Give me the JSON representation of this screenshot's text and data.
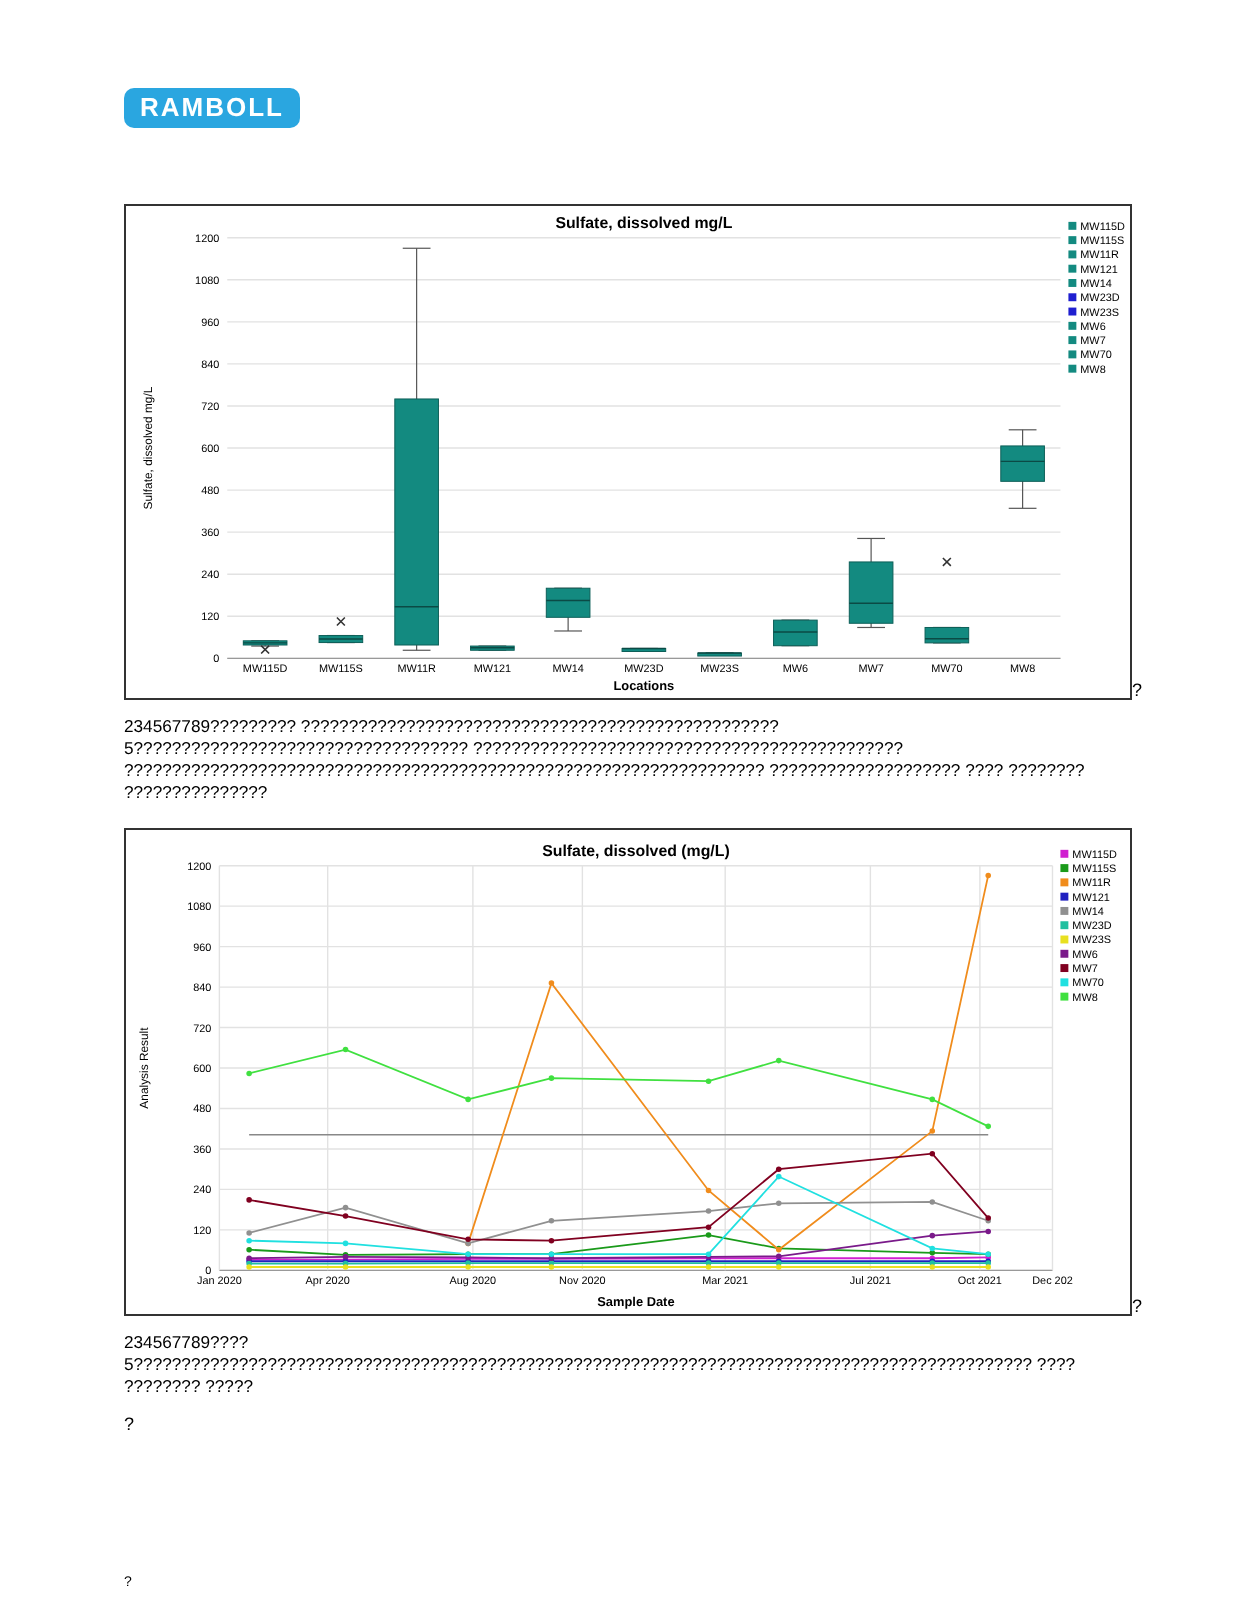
{
  "logo": {
    "text": "RAMBOLL"
  },
  "box_chart": {
    "kind": "picture",
    "title": "Sulfate, dissolved mg/L",
    "xlabel": "Locations",
    "ylabel": "Sulfate, dissolved mg/L",
    "yticks": [
      "1200",
      "1080",
      "960",
      "840",
      "720",
      "600",
      "480",
      "360",
      "240",
      "120",
      "0"
    ],
    "categories": [
      "MW115D",
      "MW115S",
      "MW11R",
      "MW121",
      "MW14",
      "MW23D",
      "MW23S",
      "MW6",
      "MW7",
      "MW70",
      "MW8"
    ],
    "legend": [
      {
        "label": "MW115D",
        "color": "#138a80"
      },
      {
        "label": "MW115S",
        "color": "#138a80"
      },
      {
        "label": "MW11R",
        "color": "#138a80"
      },
      {
        "label": "MW121",
        "color": "#138a80"
      },
      {
        "label": "MW14",
        "color": "#138a80"
      },
      {
        "label": "MW23D",
        "color": "#1f1fd0"
      },
      {
        "label": "MW23S",
        "color": "#1f1fd0"
      },
      {
        "label": "MW6",
        "color": "#138a80"
      },
      {
        "label": "MW7",
        "color": "#138a80"
      },
      {
        "label": "MW70",
        "color": "#138a80"
      },
      {
        "label": "MW8",
        "color": "#138a80"
      }
    ]
  },
  "mark_1": "?",
  "paragraph_1": "234567789????????? ??????????????????????????????????????????????????                      5??????????????????????????????????? ????????????????????????????????????????????? ??????????????????????????????????????????????????????????????????? ???????????????????? ????  ???????? ???????????????",
  "line_chart": {
    "chart_data": {
      "type": "line",
      "title": "Sulfate, dissolved (mg/L)",
      "xlabel": "Sample Date",
      "ylabel": "Analysis Result",
      "ylim": [
        0,
        1200
      ],
      "yticks": [
        0,
        120,
        240,
        360,
        480,
        600,
        720,
        840,
        960,
        1080,
        1200
      ],
      "xlim": [
        "2020-01-01",
        "2021-12-01"
      ],
      "grid": true,
      "legend": "right",
      "ref_lines": [
        {
          "axis": "y",
          "value": 402
        }
      ],
      "xticks": [
        {
          "value": "2020-01-01",
          "label": "Jan 2020"
        },
        {
          "value": "2020-04-01",
          "label": "Apr 2020"
        },
        {
          "value": "2020-08-01",
          "label": "Aug 2020"
        },
        {
          "value": "2020-11-01",
          "label": "Nov 2020"
        },
        {
          "value": "2021-03-01",
          "label": "Mar 2021"
        },
        {
          "value": "2021-07-01",
          "label": "Jul 2021"
        },
        {
          "value": "2021-10-01",
          "label": "Oct 2021"
        },
        {
          "value": "2021-12-01",
          "label": "Dec 202"
        }
      ],
      "x": [
        "2020-01-26",
        "2020-04-16",
        "2020-07-28",
        "2020-10-06",
        "2021-02-15",
        "2021-04-15",
        "2021-08-22",
        "2021-10-08"
      ],
      "series": [
        {
          "name": "MW115D",
          "color": "#d020d0",
          "values": [
            32,
            32,
            34,
            34,
            36,
            36,
            36,
            38
          ]
        },
        {
          "name": "MW115S",
          "color": "#1a9a1a",
          "values": [
            61,
            46,
            48,
            48,
            105,
            65,
            52,
            48
          ]
        },
        {
          "name": "MW11R",
          "color": "#f08c1c",
          "values": [
            null,
            null,
            80,
            852,
            237,
            61,
            413,
            1171
          ]
        },
        {
          "name": "MW121",
          "color": "#2020c0",
          "values": [
            27,
            27,
            27,
            27,
            27,
            27,
            27,
            27
          ]
        },
        {
          "name": "MW14",
          "color": "#909090",
          "values": [
            111,
            186,
            80,
            147,
            176,
            199,
            203,
            147
          ]
        },
        {
          "name": "MW23D",
          "color": "#20c0a0",
          "values": [
            20,
            20,
            22,
            22,
            22,
            22,
            22,
            22
          ]
        },
        {
          "name": "MW23S",
          "color": "#e8e020",
          "values": [
            10,
            10,
            10,
            10,
            10,
            10,
            10,
            10
          ]
        },
        {
          "name": "MW6",
          "color": "#7a1a8a",
          "values": [
            36,
            40,
            38,
            36,
            40,
            42,
            103,
            115
          ]
        },
        {
          "name": "MW7",
          "color": "#800020",
          "values": [
            209,
            161,
            92,
            88,
            128,
            300,
            346,
            155
          ]
        },
        {
          "name": "MW70",
          "color": "#20e0e0",
          "values": [
            88,
            80,
            48,
            48,
            48,
            278,
            65,
            48
          ]
        },
        {
          "name": "MW8",
          "color": "#40e040",
          "values": [
            584,
            655,
            507,
            570,
            561,
            622,
            507,
            427
          ]
        }
      ]
    }
  },
  "mark_2": "?",
  "paragraph_2": "234567789????5?????????????????????????????????????????????????????????????????????????????????????????????? ????  ???????? ?????",
  "mark_3": "?",
  "mark_4": "?"
}
